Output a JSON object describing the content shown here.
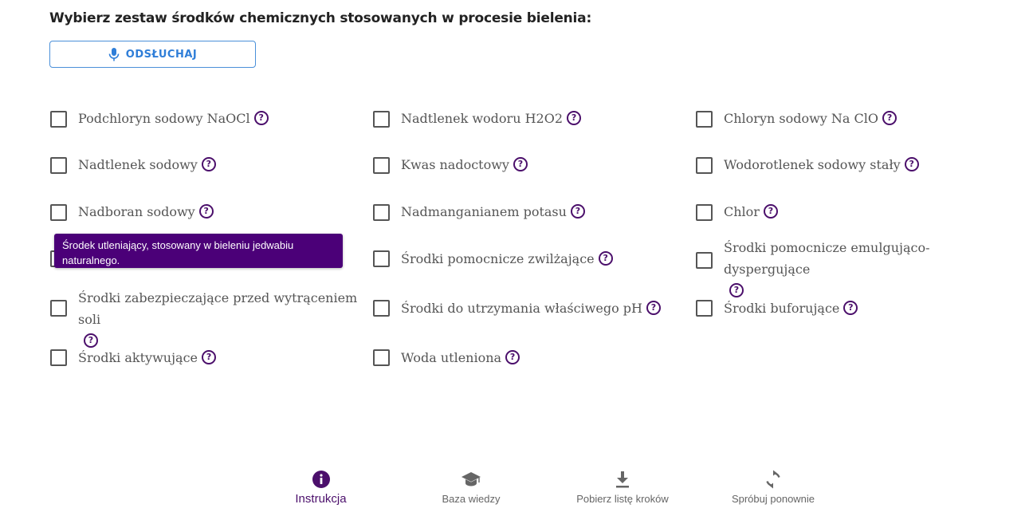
{
  "question": "Wybierz zestaw środków chemicznych stosowanych w procesie bielenia:",
  "listen_button": {
    "label": "ODSŁUCHAJ",
    "icon": "microphone-icon"
  },
  "options": [
    {
      "label": "Podchloryn sodowy NaOCl"
    },
    {
      "label": "Nadtlenek wodoru H2O2"
    },
    {
      "label": "Chloryn sodowy Na ClO"
    },
    {
      "label": "Nadtlenek sodowy"
    },
    {
      "label": "Kwas nadoctowy"
    },
    {
      "label": "Wodorotlenek sodowy stały"
    },
    {
      "label": "Nadboran sodowy"
    },
    {
      "label": "Nadmanganianem potasu"
    },
    {
      "label": "Chlor"
    },
    {
      "label": "Środki pomocnicze zwilżające"
    },
    {
      "label": "Środki pomocnicze emulgująco- dyspergujące"
    },
    {
      "label": "Środki zabezpieczające przed wytrąceniem soli"
    },
    {
      "label": "Środki do utrzymania właściwego pH"
    },
    {
      "label": "Środki buforujące"
    },
    {
      "label": "Środki aktywujące"
    },
    {
      "label": "Woda utleniona"
    }
  ],
  "tooltip": "Środek utleniający, stosowany w bieleniu jedwabiu naturalnego.",
  "footer": {
    "items": [
      {
        "label": "Instrukcja",
        "icon": "info-icon",
        "active": true
      },
      {
        "label": "Baza wiedzy",
        "icon": "graduation-cap-icon",
        "active": false
      },
      {
        "label": "Pobierz listę kroków",
        "icon": "download-icon",
        "active": false
      },
      {
        "label": "Spróbuj ponownie",
        "icon": "retry-icon",
        "active": false
      }
    ]
  },
  "colors": {
    "accent": "#4b0f6b",
    "button_text": "#2f7ed8",
    "tooltip_bg": "#4b0078"
  }
}
